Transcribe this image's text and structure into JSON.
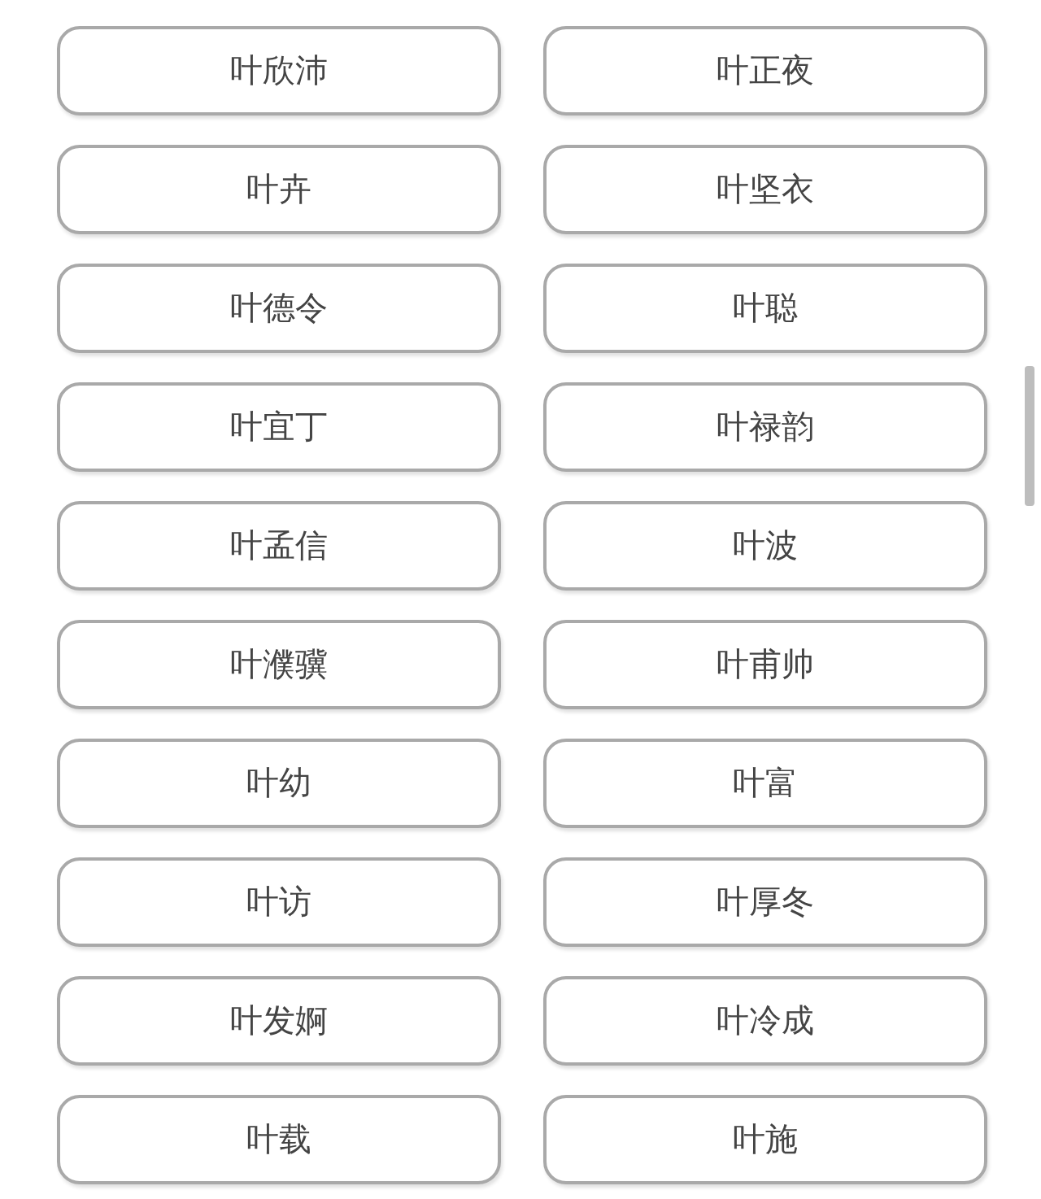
{
  "buttons": [
    {
      "label": "叶欣沛"
    },
    {
      "label": "叶正夜"
    },
    {
      "label": "叶卉"
    },
    {
      "label": "叶坚衣"
    },
    {
      "label": "叶德令"
    },
    {
      "label": "叶聪"
    },
    {
      "label": "叶宜丁"
    },
    {
      "label": "叶禄韵"
    },
    {
      "label": "叶孟信"
    },
    {
      "label": "叶波"
    },
    {
      "label": "叶濮骥"
    },
    {
      "label": "叶甫帅"
    },
    {
      "label": "叶幼"
    },
    {
      "label": "叶富"
    },
    {
      "label": "叶访"
    },
    {
      "label": "叶厚冬"
    },
    {
      "label": "叶发婀"
    },
    {
      "label": "叶冷成"
    },
    {
      "label": "叶载"
    },
    {
      "label": "叶施"
    }
  ]
}
